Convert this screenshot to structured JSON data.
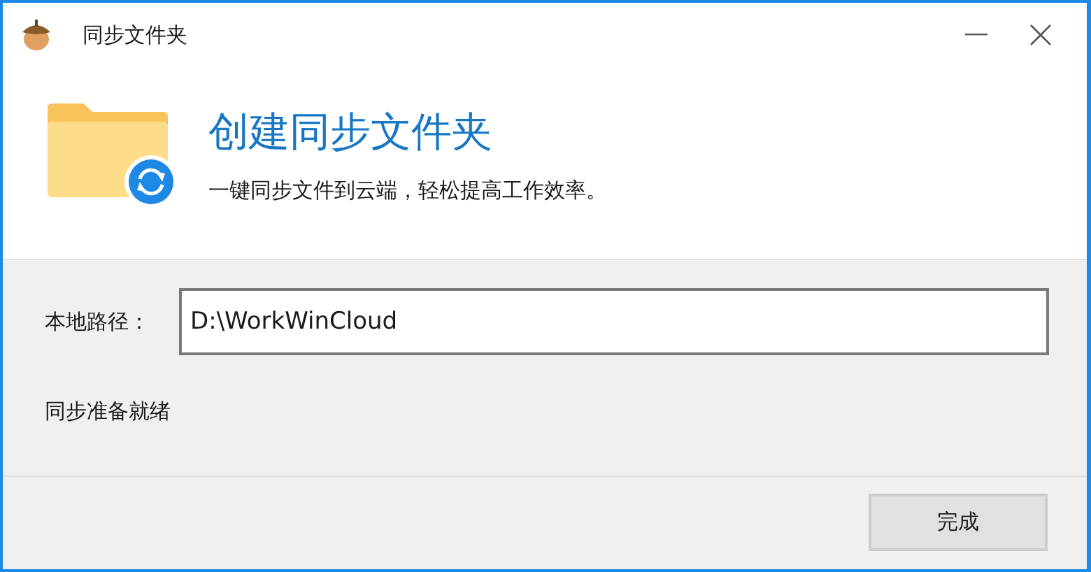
{
  "window": {
    "title": "同步文件夹"
  },
  "header": {
    "title": "创建同步文件夹",
    "subtitle": "一键同步文件到云端，轻松提高工作效率。"
  },
  "path": {
    "label": "本地路径：",
    "value": "D:\\WorkWinCloud"
  },
  "status": "同步准备就绪",
  "buttons": [
    "完成"
  ]
}
